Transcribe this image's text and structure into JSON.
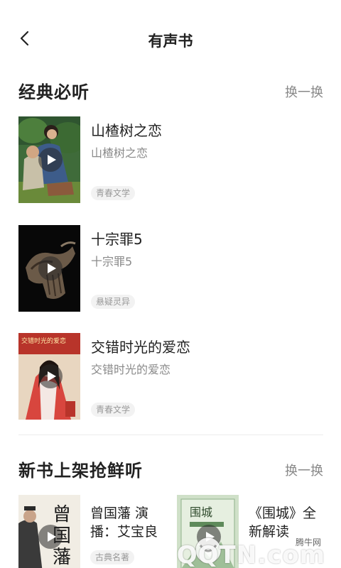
{
  "header": {
    "title": "有声书"
  },
  "sections": [
    {
      "title": "经典必听",
      "action": "换一换",
      "books": [
        {
          "title": "山楂树之恋",
          "subtitle": "山楂树之恋",
          "tag": "青春文学"
        },
        {
          "title": "十宗罪5",
          "subtitle": "十宗罪5",
          "tag": "悬疑灵异"
        },
        {
          "title": "交错时光的爱恋",
          "subtitle": "交错时光的爱恋",
          "tag": "青春文学",
          "cover_text": "交错时光的爱恋"
        }
      ]
    },
    {
      "title": "新书上架抢鲜听",
      "action": "换一换",
      "books": [
        {
          "title": "曾国藩 演播：艾宝良",
          "tag": "古典名著",
          "cover_text": "曾国藩"
        },
        {
          "title": "《围城》全新解读",
          "cover_text": "围城"
        }
      ]
    }
  ],
  "watermark": {
    "small": "腾牛网",
    "big": "QQTN.com"
  }
}
